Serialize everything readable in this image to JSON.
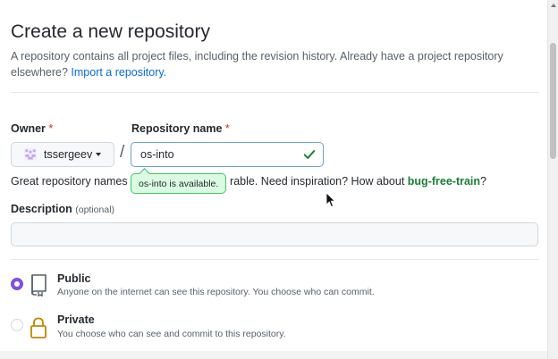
{
  "page": {
    "title": "Create a new repository",
    "subtitle_text": "A repository contains all project files, including the revision history. Already have a project repository elsewhere? ",
    "import_link": "Import a repository."
  },
  "owner": {
    "label": "Owner",
    "required_mark": "*",
    "selected": "tssergeev"
  },
  "separator": "/",
  "repo_name": {
    "label": "Repository name",
    "required_mark": "*",
    "value": "os-into",
    "availability": "os-into is available."
  },
  "hint": {
    "before": "Great repository names a",
    "after": "rable. Need inspiration? How about ",
    "suggestion": "bug-free-train",
    "end": "?"
  },
  "description": {
    "label": "Description",
    "optional": "(optional)",
    "value": ""
  },
  "visibility": {
    "selected": "public",
    "public": {
      "title": "Public",
      "description": "Anyone on the internet can see this repository. You choose who can commit."
    },
    "private": {
      "title": "Private",
      "description": "You choose who can see and commit to this repository."
    }
  },
  "colors": {
    "accent_radio": "#8250df",
    "success": "#1a7f37",
    "link": "#0969da",
    "required": "#cf222e"
  },
  "icons": {
    "owner_avatar": "identicon-avatar",
    "available": "check-icon",
    "public": "repo-icon",
    "private": "lock-icon"
  }
}
